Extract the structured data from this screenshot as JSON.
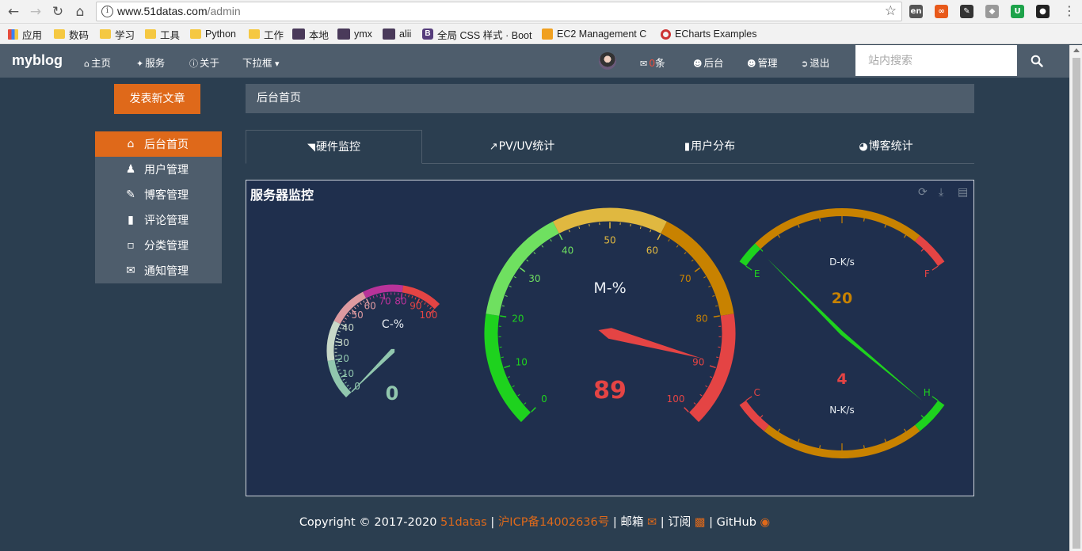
{
  "browser": {
    "url_host": "www.51datas.com",
    "url_path": "/admin",
    "bookmarks": [
      "应用",
      "数码",
      "学习",
      "工具",
      "Python",
      "工作",
      "本地",
      "ymx",
      "alii",
      "全局 CSS 样式 · Boot",
      "EC2 Management C",
      "ECharts Examples"
    ]
  },
  "navbar": {
    "brand": "myblog",
    "home": "主页",
    "services": "服务",
    "about": "关于",
    "dropdown": "下拉框",
    "message_count": "0",
    "message_unit": "条",
    "backend": "后台",
    "manage": "管理",
    "logout": "退出",
    "search_placeholder": "站内搜索"
  },
  "sidebar": {
    "new_post": "发表新文章",
    "items": [
      {
        "label": "后台首页",
        "icon": "home-icon",
        "active": true
      },
      {
        "label": "用户管理",
        "icon": "user-icon",
        "active": false
      },
      {
        "label": "博客管理",
        "icon": "pencil-icon",
        "active": false
      },
      {
        "label": "评论管理",
        "icon": "comment-icon",
        "active": false
      },
      {
        "label": "分类管理",
        "icon": "folder-open-icon",
        "active": false
      },
      {
        "label": "通知管理",
        "icon": "envelope-icon",
        "active": false
      }
    ]
  },
  "main": {
    "breadcrumb": "后台首页",
    "tabs": [
      {
        "label": "硬件监控",
        "icon": "area-chart-icon",
        "active": true
      },
      {
        "label": "PV/UV统计",
        "icon": "line-chart-icon",
        "active": false
      },
      {
        "label": "用户分布",
        "icon": "bar-chart-icon",
        "active": false
      },
      {
        "label": "博客统计",
        "icon": "pie-chart-icon",
        "active": false
      }
    ],
    "panel_title": "服务器监控"
  },
  "chart_data": [
    {
      "type": "gauge",
      "title": "C-%",
      "min": 0,
      "max": 100,
      "value": 0,
      "tick_labels": [
        "0",
        "10",
        "20",
        "30",
        "40",
        "50",
        "60",
        "70",
        "80",
        "90",
        "100"
      ],
      "color_bands": [
        {
          "to": 0.2,
          "color": "#91c7ae"
        },
        {
          "to": 0.4,
          "color": "#c8d8c8"
        },
        {
          "to": 0.6,
          "color": "#dd9aa0"
        },
        {
          "to": 0.8,
          "color": "#b8339a"
        },
        {
          "to": 1.0,
          "color": "#e44444"
        }
      ]
    },
    {
      "type": "gauge",
      "title": "M-%",
      "min": 0,
      "max": 100,
      "value": 89,
      "tick_labels": [
        "0",
        "10",
        "20",
        "30",
        "40",
        "50",
        "60",
        "70",
        "80",
        "90",
        "100"
      ],
      "color_bands": [
        {
          "to": 0.2,
          "color": "#1ed21e"
        },
        {
          "to": 0.4,
          "color": "#6fe060"
        },
        {
          "to": 0.6,
          "color": "#e0b840"
        },
        {
          "to": 0.8,
          "color": "#c88200"
        },
        {
          "to": 1.0,
          "color": "#e44444"
        }
      ]
    },
    {
      "type": "gauge",
      "title": "D-K/s",
      "value": 20,
      "left_label": "E",
      "right_label": "F",
      "color_bands": [
        {
          "to": 0.1,
          "color": "#1ed21e"
        },
        {
          "to": 0.85,
          "color": "#c88200"
        },
        {
          "to": 1.0,
          "color": "#e44444"
        }
      ]
    },
    {
      "type": "gauge",
      "title": "N-K/s",
      "value": 4,
      "left_label": "C",
      "right_label": "H",
      "color_bands": [
        {
          "to": 0.15,
          "color": "#e44444"
        },
        {
          "to": 0.85,
          "color": "#c88200"
        },
        {
          "to": 1.0,
          "color": "#1ed21e"
        }
      ]
    }
  ],
  "footer": {
    "copyright": "Copyright © 2017-2020",
    "site": "51datas",
    "sep": "|",
    "icp": "沪ICP备14002636号",
    "mail": "邮箱",
    "subscribe": "订阅",
    "github": "GitHub"
  },
  "colors": {
    "accent": "#df691a",
    "navbar": "#4e5d6c",
    "background": "#2b3e50",
    "panel": "#1f2f4d"
  }
}
